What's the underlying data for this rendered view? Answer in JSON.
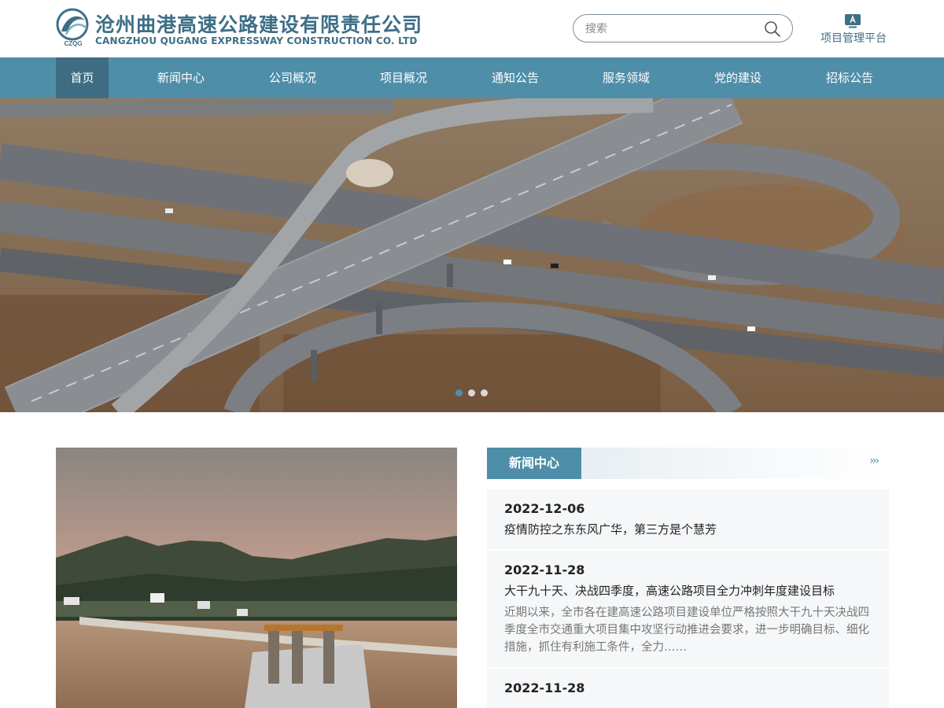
{
  "header": {
    "company_cn": "沧州曲港高速公路建设有限责任公司",
    "company_en": "CANGZHOU QUGANG EXPRESSWAY CONSTRUCTION CO. LTD",
    "logo_abbr": "CZQG",
    "search_placeholder": "搜索",
    "platform_label": "项目管理平台"
  },
  "nav": {
    "items": [
      {
        "label": "首页",
        "active": true
      },
      {
        "label": "新闻中心"
      },
      {
        "label": "公司概况"
      },
      {
        "label": "项目概况"
      },
      {
        "label": "通知公告"
      },
      {
        "label": "服务领域"
      },
      {
        "label": "党的建设"
      },
      {
        "label": "招标公告"
      }
    ]
  },
  "hero": {
    "slide_count": 3,
    "active_slide": 1
  },
  "news": {
    "title": "新闻中心",
    "more": "›››",
    "items": [
      {
        "date": "2022-12-06",
        "headline": "疫情防控之东东风广华，第三方是个慧芳",
        "summary": ""
      },
      {
        "date": "2022-11-28",
        "headline": "大干九十天、决战四季度，高速公路项目全力冲刺年度建设目标",
        "summary": "近期以来，全市各在建高速公路项目建设单位严格按照大干九十天决战四季度全市交通重大项目集中攻坚行动推进会要求，进一步明确目标、细化措施，抓住有利施工条件，全力……"
      },
      {
        "date": "2022-11-28",
        "headline": "",
        "summary": ""
      }
    ]
  },
  "colors": {
    "brand": "#3e6f86",
    "nav_bg": "#4f8ea9",
    "nav_active": "#3e6c82"
  },
  "icons": {
    "search": "magnifier-icon",
    "platform": "monitor-icon"
  }
}
